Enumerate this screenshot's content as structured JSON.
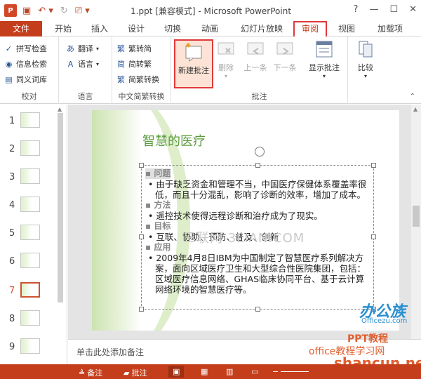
{
  "titlebar": {
    "doc_title": "1.ppt [兼容模式] - Microsoft PowerPoint",
    "app_logo": "P",
    "controls": [
      "?",
      "—",
      "☐",
      "✕"
    ]
  },
  "tabs": {
    "file": "文件",
    "items": [
      "开始",
      "插入",
      "设计",
      "切换",
      "动画",
      "幻灯片放映",
      "审阅",
      "视图",
      "加载项"
    ]
  },
  "ribbon": {
    "proofing": {
      "label": "校对",
      "spell": "拼写检查",
      "research": "信息检索",
      "thesaurus": "同义词库"
    },
    "language": {
      "label": "语言",
      "translate": "翻译",
      "language": "语言"
    },
    "chinese": {
      "label": "中文简繁转换",
      "to_trad": "繁转简",
      "to_simp": "简转繁",
      "convert": "简繁转换"
    },
    "comments": {
      "label": "批注",
      "new": "新建批注",
      "delete": "删除",
      "prev": "上一条",
      "next": "下一条",
      "show": "显示批注"
    },
    "compare": {
      "label": "比较"
    }
  },
  "slides": {
    "numbers": [
      "1",
      "2",
      "3",
      "4",
      "5",
      "6",
      "7",
      "8",
      "9"
    ],
    "selected": "7"
  },
  "slide": {
    "title": "智慧的医疗",
    "h1": "问题",
    "b1": "由于缺乏资金和管理不当，中国医疗保健体系覆盖率很低，而且十分混乱，影响了诊断的效率，增加了成本。",
    "h2": "方法",
    "b2": "遥控技术使得远程诊断和治疗成为了现实。",
    "h3": "目标",
    "b3": "互联、协助、预防、普及、创新",
    "h4": "应用",
    "b4": "2009年4月8日IBM为中国制定了智慧医疗系列解决方案，面向区域医疗卫生和大型综合性医院集团，包括：区域医疗信息网络、GHAS临床协同平台、基于云计算网络环境的智慧医疗等。",
    "watermark": "三联网 3LIAN.COM"
  },
  "notes": {
    "placeholder": "单击此处添加备注"
  },
  "statusbar": {
    "notes": "备注",
    "comments": "批注"
  },
  "overlays": {
    "logo1": "办公族",
    "logo1_sub": "Officezu.com",
    "logo2": "PPT教程",
    "logo3": "office教程学习网",
    "logo4": "shancun.net"
  },
  "colors": {
    "accent": "#c43e1c",
    "title_green": "#5a9c3c",
    "highlight_red": "#e03a3a"
  }
}
